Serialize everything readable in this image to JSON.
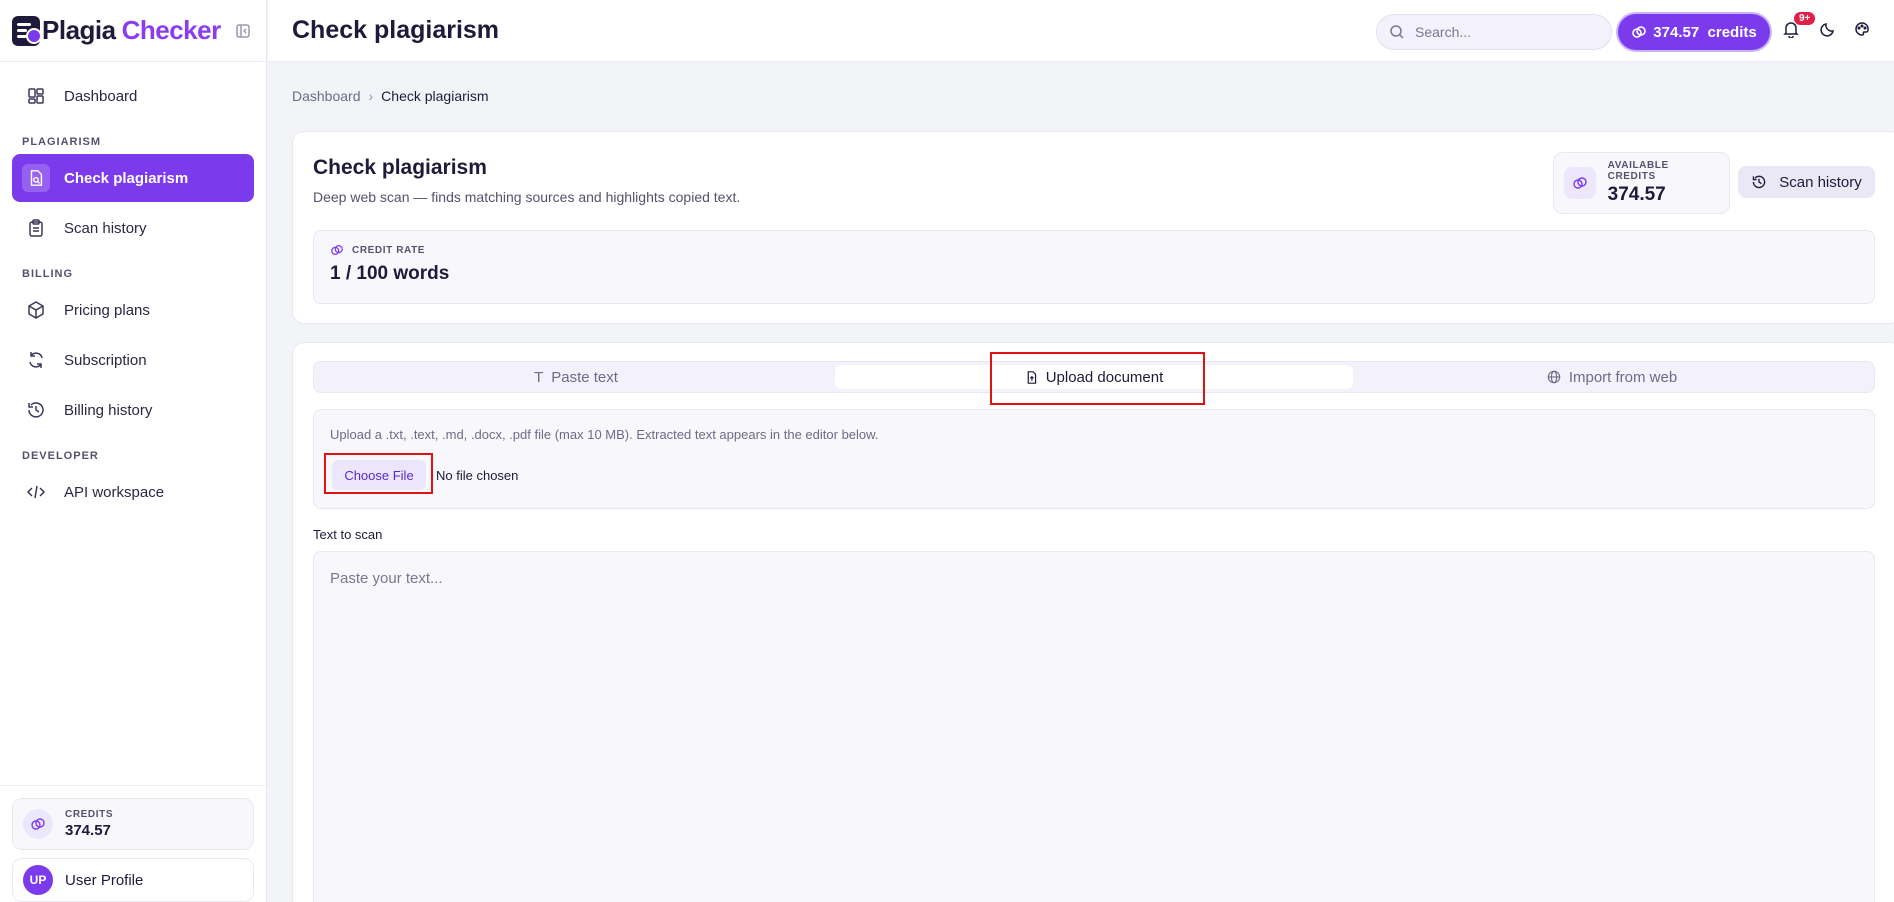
{
  "brand": {
    "name_part1": "Plagia",
    "name_part2": "Checker"
  },
  "sidebar": {
    "items": [
      {
        "label": "Dashboard"
      },
      {
        "section": "PLAGIARISM"
      },
      {
        "label": "Check plagiarism",
        "active": true
      },
      {
        "label": "Scan history"
      },
      {
        "section": "BILLING"
      },
      {
        "label": "Pricing plans"
      },
      {
        "label": "Subscription"
      },
      {
        "label": "Billing history"
      },
      {
        "section": "DEVELOPER"
      },
      {
        "label": "API workspace"
      }
    ],
    "credits": {
      "label": "CREDITS",
      "value": "374.57"
    },
    "profile": {
      "initials": "UP",
      "name": "User Profile"
    }
  },
  "header": {
    "title": "Check plagiarism",
    "search_placeholder": "Search...",
    "credits_pill": "374.57  credits",
    "notifications_badge": "9+"
  },
  "breadcrumb": {
    "root": "Dashboard",
    "current": "Check plagiarism"
  },
  "main": {
    "title": "Check plagiarism",
    "subtitle": "Deep web scan — finds matching sources and highlights copied text.",
    "available_credits": {
      "label": "AVAILABLE CREDITS",
      "value": "374.57"
    },
    "scan_history_button": "Scan history",
    "credit_rate": {
      "label": "CREDIT RATE",
      "value": "1 / 100 words"
    },
    "tabs": [
      {
        "label": "Paste text"
      },
      {
        "label": "Upload document",
        "active": true
      },
      {
        "label": "Import from web"
      }
    ],
    "upload": {
      "hint": "Upload a .txt, .text, .md, .docx, .pdf file (max 10 MB). Extracted text appears in the editor below.",
      "choose_button": "Choose File",
      "file_status": "No file chosen"
    },
    "text_label": "Text to scan",
    "text_placeholder": "Paste your text..."
  },
  "colors": {
    "accent": "#7c3aed",
    "badge": "#e11d48",
    "highlight": "#e01313"
  }
}
